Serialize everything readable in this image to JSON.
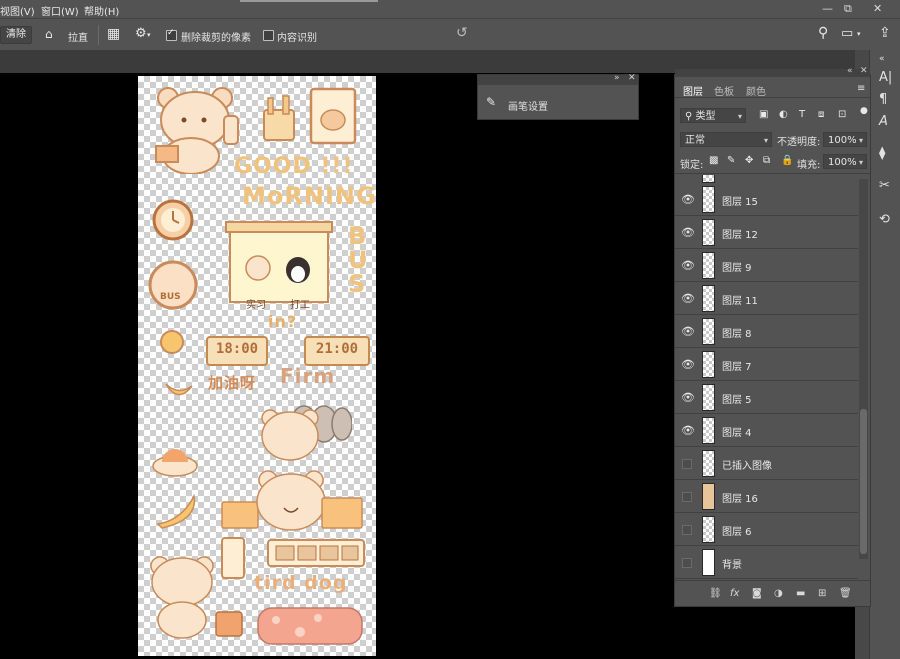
{
  "menu": {
    "view": "视图(V)",
    "window": "窗口(W)",
    "help": "帮助(H)"
  },
  "window_controls": {
    "minimize": "—",
    "restore": "⧉",
    "close": "✕"
  },
  "options_bar": {
    "clear_button": "清除",
    "straighten": "拉直",
    "delete_cropped": "删除裁剪的像素",
    "delete_cropped_checked": true,
    "content_aware": "内容识别",
    "content_aware_checked": false
  },
  "brush_panel": {
    "collapse": "»",
    "close": "✕",
    "title": "画笔设置"
  },
  "layers_panel": {
    "collapse": "«",
    "close": "✕",
    "tabs": [
      "图层",
      "色板",
      "颜色"
    ],
    "active_tab": 0,
    "filter_kind": "类型",
    "blend_mode": "正常",
    "opacity_label": "不透明度:",
    "opacity_value": "100%",
    "lock_label": "锁定:",
    "fill_label": "填充:",
    "fill_value": "100%",
    "layers": [
      {
        "name": "图层 15",
        "visible": true
      },
      {
        "name": "图层 12",
        "visible": true
      },
      {
        "name": "图层 9",
        "visible": true
      },
      {
        "name": "图层 11",
        "visible": true
      },
      {
        "name": "图层 8",
        "visible": true
      },
      {
        "name": "图层 7",
        "visible": true
      },
      {
        "name": "图层 5",
        "visible": true
      },
      {
        "name": "图层 4",
        "visible": true
      },
      {
        "name": "已插入图像",
        "visible": false
      },
      {
        "name": "图层 16",
        "visible": false
      },
      {
        "name": "图层 6",
        "visible": false
      },
      {
        "name": "背景",
        "visible": false
      }
    ],
    "footer_fx": "fx"
  },
  "artwork_text": {
    "good": "GOOD !!!",
    "morning": "MoRNING",
    "bus": "BUS",
    "bus_sign": "BUS",
    "time1": "18:00",
    "time2": "21:00",
    "in": "in?",
    "firm": "Firm",
    "jiayou": "加油呀",
    "tired_dog": "tird dog",
    "name_left": "实习",
    "name_right": "打工"
  },
  "colors": {
    "ui_bg": "#535353",
    "ui_dark": "#3b3b3b",
    "canvas_bg": "#000000",
    "art_orange": "#f0c27c",
    "art_brown": "#b06f38"
  }
}
